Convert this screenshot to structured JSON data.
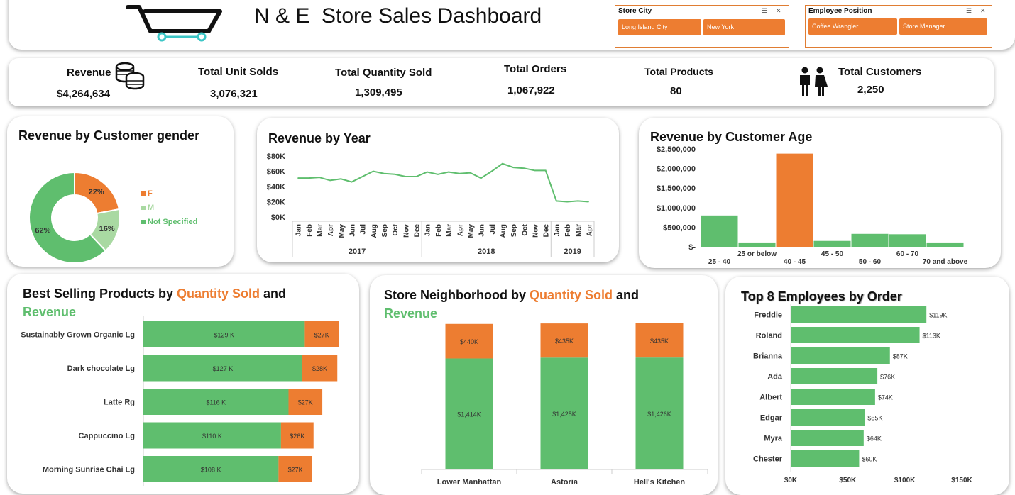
{
  "header": {
    "title": "N & E  Store Sales Dashboard"
  },
  "slicers": {
    "store_city": {
      "title": "Store City",
      "items": [
        "Long Island City",
        "New York"
      ]
    },
    "employee_position": {
      "title": "Employee Position",
      "items": [
        "Coffee Wrangler",
        "Store Manager"
      ]
    }
  },
  "kpis": [
    {
      "label": "Revenue",
      "value": "$4,264,634"
    },
    {
      "label": "Total Unit Solds",
      "value": "3,076,321"
    },
    {
      "label": "Total Quantity Sold",
      "value": "1,309,495"
    },
    {
      "label": "Total Orders",
      "value": "1,067,922"
    },
    {
      "label": "Total Products",
      "value": "80"
    },
    {
      "label": "Total Customers",
      "value": "2,250"
    }
  ],
  "titles": {
    "gender": "Revenue by Customer gender",
    "year": "Revenue by Year",
    "age": "Revenue by Customer Age",
    "products_a": "Best Selling Products by ",
    "products_b": "Quantity Sold",
    "products_c": " and",
    "products_d": "Revenue",
    "neigh_a": "Store Neighborhood by ",
    "neigh_b": "Quantity Sold",
    "neigh_c": " and",
    "neigh_d": "Revenue",
    "employees": "Top 8 Employees by Order"
  },
  "colors": {
    "green": "#5fbe6e",
    "orange": "#ed7d31",
    "teal": "#3cc6c6"
  },
  "chart_data": [
    {
      "type": "pie",
      "id": "gender",
      "title": "Revenue by Customer gender",
      "categories": [
        "F",
        "M",
        "Not Specified"
      ],
      "values": [
        22,
        16,
        62
      ],
      "labels": [
        "22%",
        "16%",
        "62%"
      ],
      "colors": [
        "#ed7d31",
        "#a9d9a2",
        "#5fbe6e"
      ]
    },
    {
      "type": "line",
      "id": "year",
      "title": "Revenue by Year",
      "months": [
        "Jan",
        "Feb",
        "Mar",
        "Apr",
        "May",
        "Jun",
        "Jul",
        "Aug",
        "Sep",
        "Oct",
        "Nov",
        "Dec",
        "Jan",
        "Feb",
        "Mar",
        "Apr",
        "May",
        "Jun",
        "Jul",
        "Aug",
        "Sep",
        "Oct",
        "Nov",
        "Dec",
        "Jan",
        "Feb",
        "Mar",
        "Apr"
      ],
      "years": [
        {
          "label": "2017",
          "count": 12
        },
        {
          "label": "2018",
          "count": 12
        },
        {
          "label": "2019",
          "count": 4
        }
      ],
      "values": [
        51,
        51,
        52,
        48,
        50,
        46,
        53,
        60,
        57,
        56,
        53,
        53,
        59,
        56,
        59,
        57,
        58,
        51,
        60,
        70,
        65,
        64,
        61,
        61,
        21,
        20,
        21,
        20
      ],
      "ylim": [
        0,
        80
      ],
      "yticks": [
        "$0K",
        "$20K",
        "$40K",
        "$60K",
        "$80K"
      ]
    },
    {
      "type": "bar",
      "id": "age",
      "title": "Revenue by Customer Age",
      "categories": [
        "25 - 40",
        "25 or below",
        "40 - 45",
        "45 - 50",
        "50 - 60",
        "60 - 70",
        "70 and above"
      ],
      "values": [
        800000,
        110000,
        2380000,
        150000,
        330000,
        320000,
        110000
      ],
      "highlight": 2,
      "ylim": [
        0,
        2500000
      ],
      "yticks": [
        "$-",
        "$500,000",
        "$1,000,000",
        "$1,500,000",
        "$2,000,000",
        "$2,500,000"
      ]
    },
    {
      "type": "bar",
      "id": "products",
      "categories": [
        "Sustainably Grown Organic Lg",
        "Dark chocolate Lg",
        "Latte Rg",
        "Cappuccino Lg",
        "Morning Sunrise Chai Lg"
      ],
      "series": [
        {
          "name": "Revenue",
          "values": [
            129,
            127,
            116,
            110,
            108
          ],
          "labels": [
            "$129 K",
            "$127 K",
            "$116 K",
            "$110 K",
            "$108 K"
          ]
        },
        {
          "name": "Quantity Sold",
          "values": [
            27,
            28,
            27,
            26,
            27
          ],
          "labels": [
            "$27K",
            "$28K",
            "$27K",
            "$26K",
            "$27K"
          ]
        }
      ]
    },
    {
      "type": "bar",
      "id": "neighborhood",
      "categories": [
        "Lower Manhattan",
        "Astoria",
        "Hell's Kitchen"
      ],
      "series": [
        {
          "name": "Revenue",
          "values": [
            1414,
            1425,
            1426
          ],
          "labels": [
            "$1,414K",
            "$1,425K",
            "$1,426K"
          ]
        },
        {
          "name": "Quantity Sold",
          "values": [
            440,
            435,
            435
          ],
          "labels": [
            "$440K",
            "$435K",
            "$435K"
          ]
        }
      ]
    },
    {
      "type": "bar",
      "id": "employees",
      "title": "Top 8 Employees by Order",
      "categories": [
        "Freddie",
        "Roland",
        "Brianna",
        "Ada",
        "Albert",
        "Edgar",
        "Myra",
        "Chester"
      ],
      "values": [
        119,
        113,
        87,
        76,
        74,
        65,
        64,
        60
      ],
      "labels": [
        "$119K",
        "$113K",
        "$87K",
        "$76K",
        "$74K",
        "$65K",
        "$64K",
        "$60K"
      ],
      "xlim": [
        0,
        150
      ],
      "xticks": [
        "$0K",
        "$50K",
        "$100K",
        "$150K"
      ]
    }
  ]
}
